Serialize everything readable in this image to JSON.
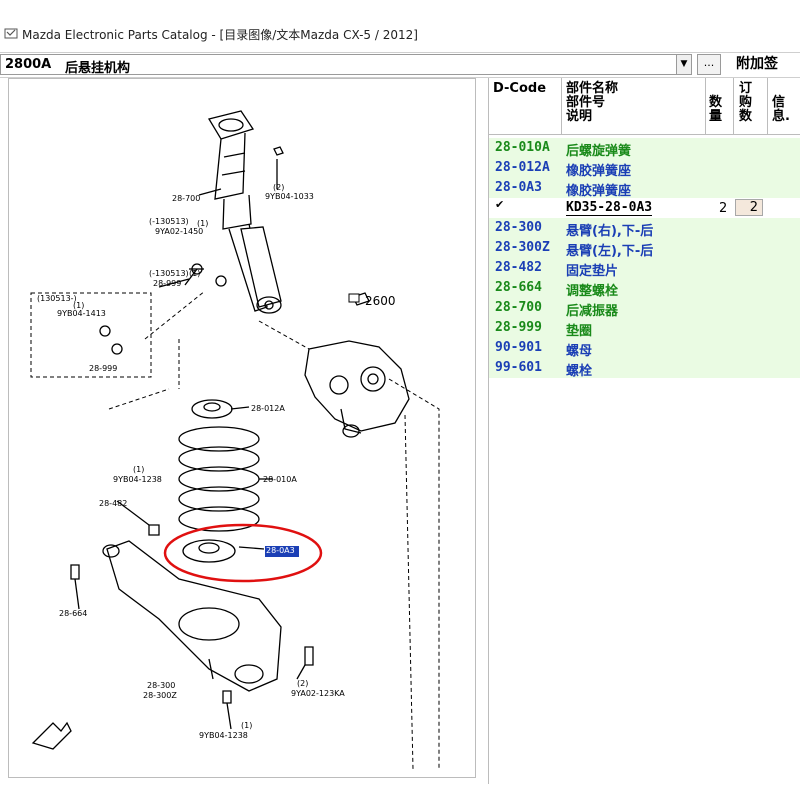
{
  "window": {
    "title": "Mazda Electronic Parts Catalog - [目录图像/文本Mazda CX-5 / 2012]"
  },
  "toolbar": {
    "group_code": "2800A",
    "group_name": "后悬挂机构",
    "more_label": "...",
    "addon_label": "附加签"
  },
  "diagram": {
    "labels": {
      "l2800": "28-700",
      "l9yb04_1033": "9YB04-1033",
      "l9yb04_1033_qty": "(2)",
      "l130513a": "(-130513)",
      "l130513a_qty": "(1)",
      "l9ya02_1450": "9YA02-1450",
      "l130513b": "(-130513)",
      "l130513b_qty": "(1)",
      "l28_999": "28-999",
      "l130513c": "(130513-)",
      "l9yb04_1413_qty": "(1)",
      "l9yb04_1413": "9YB04-1413",
      "l28_999b": "28-999",
      "l2600": "2600",
      "l28_012a": "28-012A",
      "l28_010a": "28-010A",
      "l9yb04_1238a_qty": "(1)",
      "l9yb04_1238a": "9YB04-1238",
      "l28_482": "28-482",
      "l28_0a3": "28-0A3",
      "l28_664": "28-664",
      "l28_300": "28-300",
      "l28_300z": "28-300Z",
      "l9ya02_123ka": "9YA02-123KA",
      "l9ya02_123ka_qty": "(2)",
      "l9yb04_1238b_qty": "(1)",
      "l9yb04_1238b": "9YB04-1238"
    }
  },
  "parts": {
    "headers": {
      "dcode": "D-Code",
      "name_lines": [
        "部件名称",
        "部件号",
        "说明"
      ],
      "qty_lines": [
        "数",
        "量"
      ],
      "order_lines": [
        "订",
        "购",
        "数"
      ],
      "info_lines": [
        "信",
        "息."
      ]
    },
    "rows": [
      {
        "dcode": "28-010A",
        "name": "后螺旋弹簧",
        "color": "green"
      },
      {
        "dcode": "28-012A",
        "name": "橡胶弹簧座",
        "color": "blue"
      },
      {
        "dcode": "28-0A3",
        "name": "橡胶弹簧座",
        "color": "blue"
      },
      {
        "check": "✔",
        "part_number": "KD35-28-0A3",
        "qty": "2",
        "order_qty": "2"
      },
      {
        "dcode": "28-300",
        "name": "悬臂(右),下-后",
        "color": "blue"
      },
      {
        "dcode": "28-300Z",
        "name": "悬臂(左),下-后",
        "color": "blue"
      },
      {
        "dcode": "28-482",
        "name": "固定垫片",
        "color": "blue"
      },
      {
        "dcode": "28-664",
        "name": "调整螺栓",
        "color": "green"
      },
      {
        "dcode": "28-700",
        "name": "后减振器",
        "color": "green"
      },
      {
        "dcode": "28-999",
        "name": "垫圈",
        "color": "green"
      },
      {
        "dcode": "90-901",
        "name": "螺母",
        "color": "blue"
      },
      {
        "dcode": "99-601",
        "name": "螺栓",
        "color": "blue"
      }
    ]
  }
}
